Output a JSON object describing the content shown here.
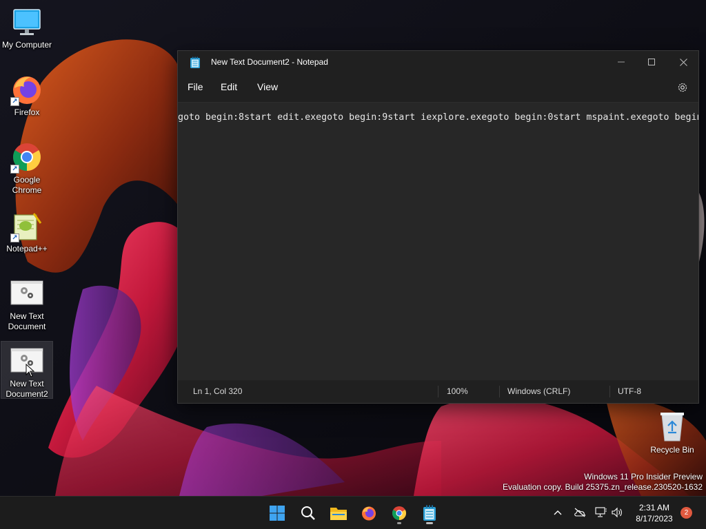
{
  "desktop": {
    "icons": [
      {
        "label": "My Computer"
      },
      {
        "label": "Firefox"
      },
      {
        "label": "Google Chrome"
      },
      {
        "label": "Notepad++"
      },
      {
        "label": "New Text Document"
      },
      {
        "label": "New Text Document2"
      }
    ],
    "recycle_bin": {
      "label": "Recycle Bin"
    }
  },
  "notepad": {
    "title": "New Text Document2 - Notepad",
    "menu": {
      "file": "File",
      "edit": "Edit",
      "view": "View"
    },
    "content": "goto begin:8start edit.exegoto begin:9start iexplore.exegoto begin:0start mspaint.exegoto begin",
    "status": {
      "position": "Ln 1, Col 320",
      "zoom": "100%",
      "line_ending": "Windows (CRLF)",
      "encoding": "UTF-8"
    }
  },
  "watermark": {
    "line1": "Windows 11 Pro Insider Preview",
    "line2": "Evaluation copy. Build 25375.zn_release.230520-1632"
  },
  "taskbar": {
    "time": "2:31 AM",
    "date": "8/17/2023",
    "notification_count": "2"
  },
  "colors": {
    "accent": "#0078d4",
    "window_bg": "#202020",
    "editor_bg": "#272727",
    "badge": "#e0593f"
  }
}
